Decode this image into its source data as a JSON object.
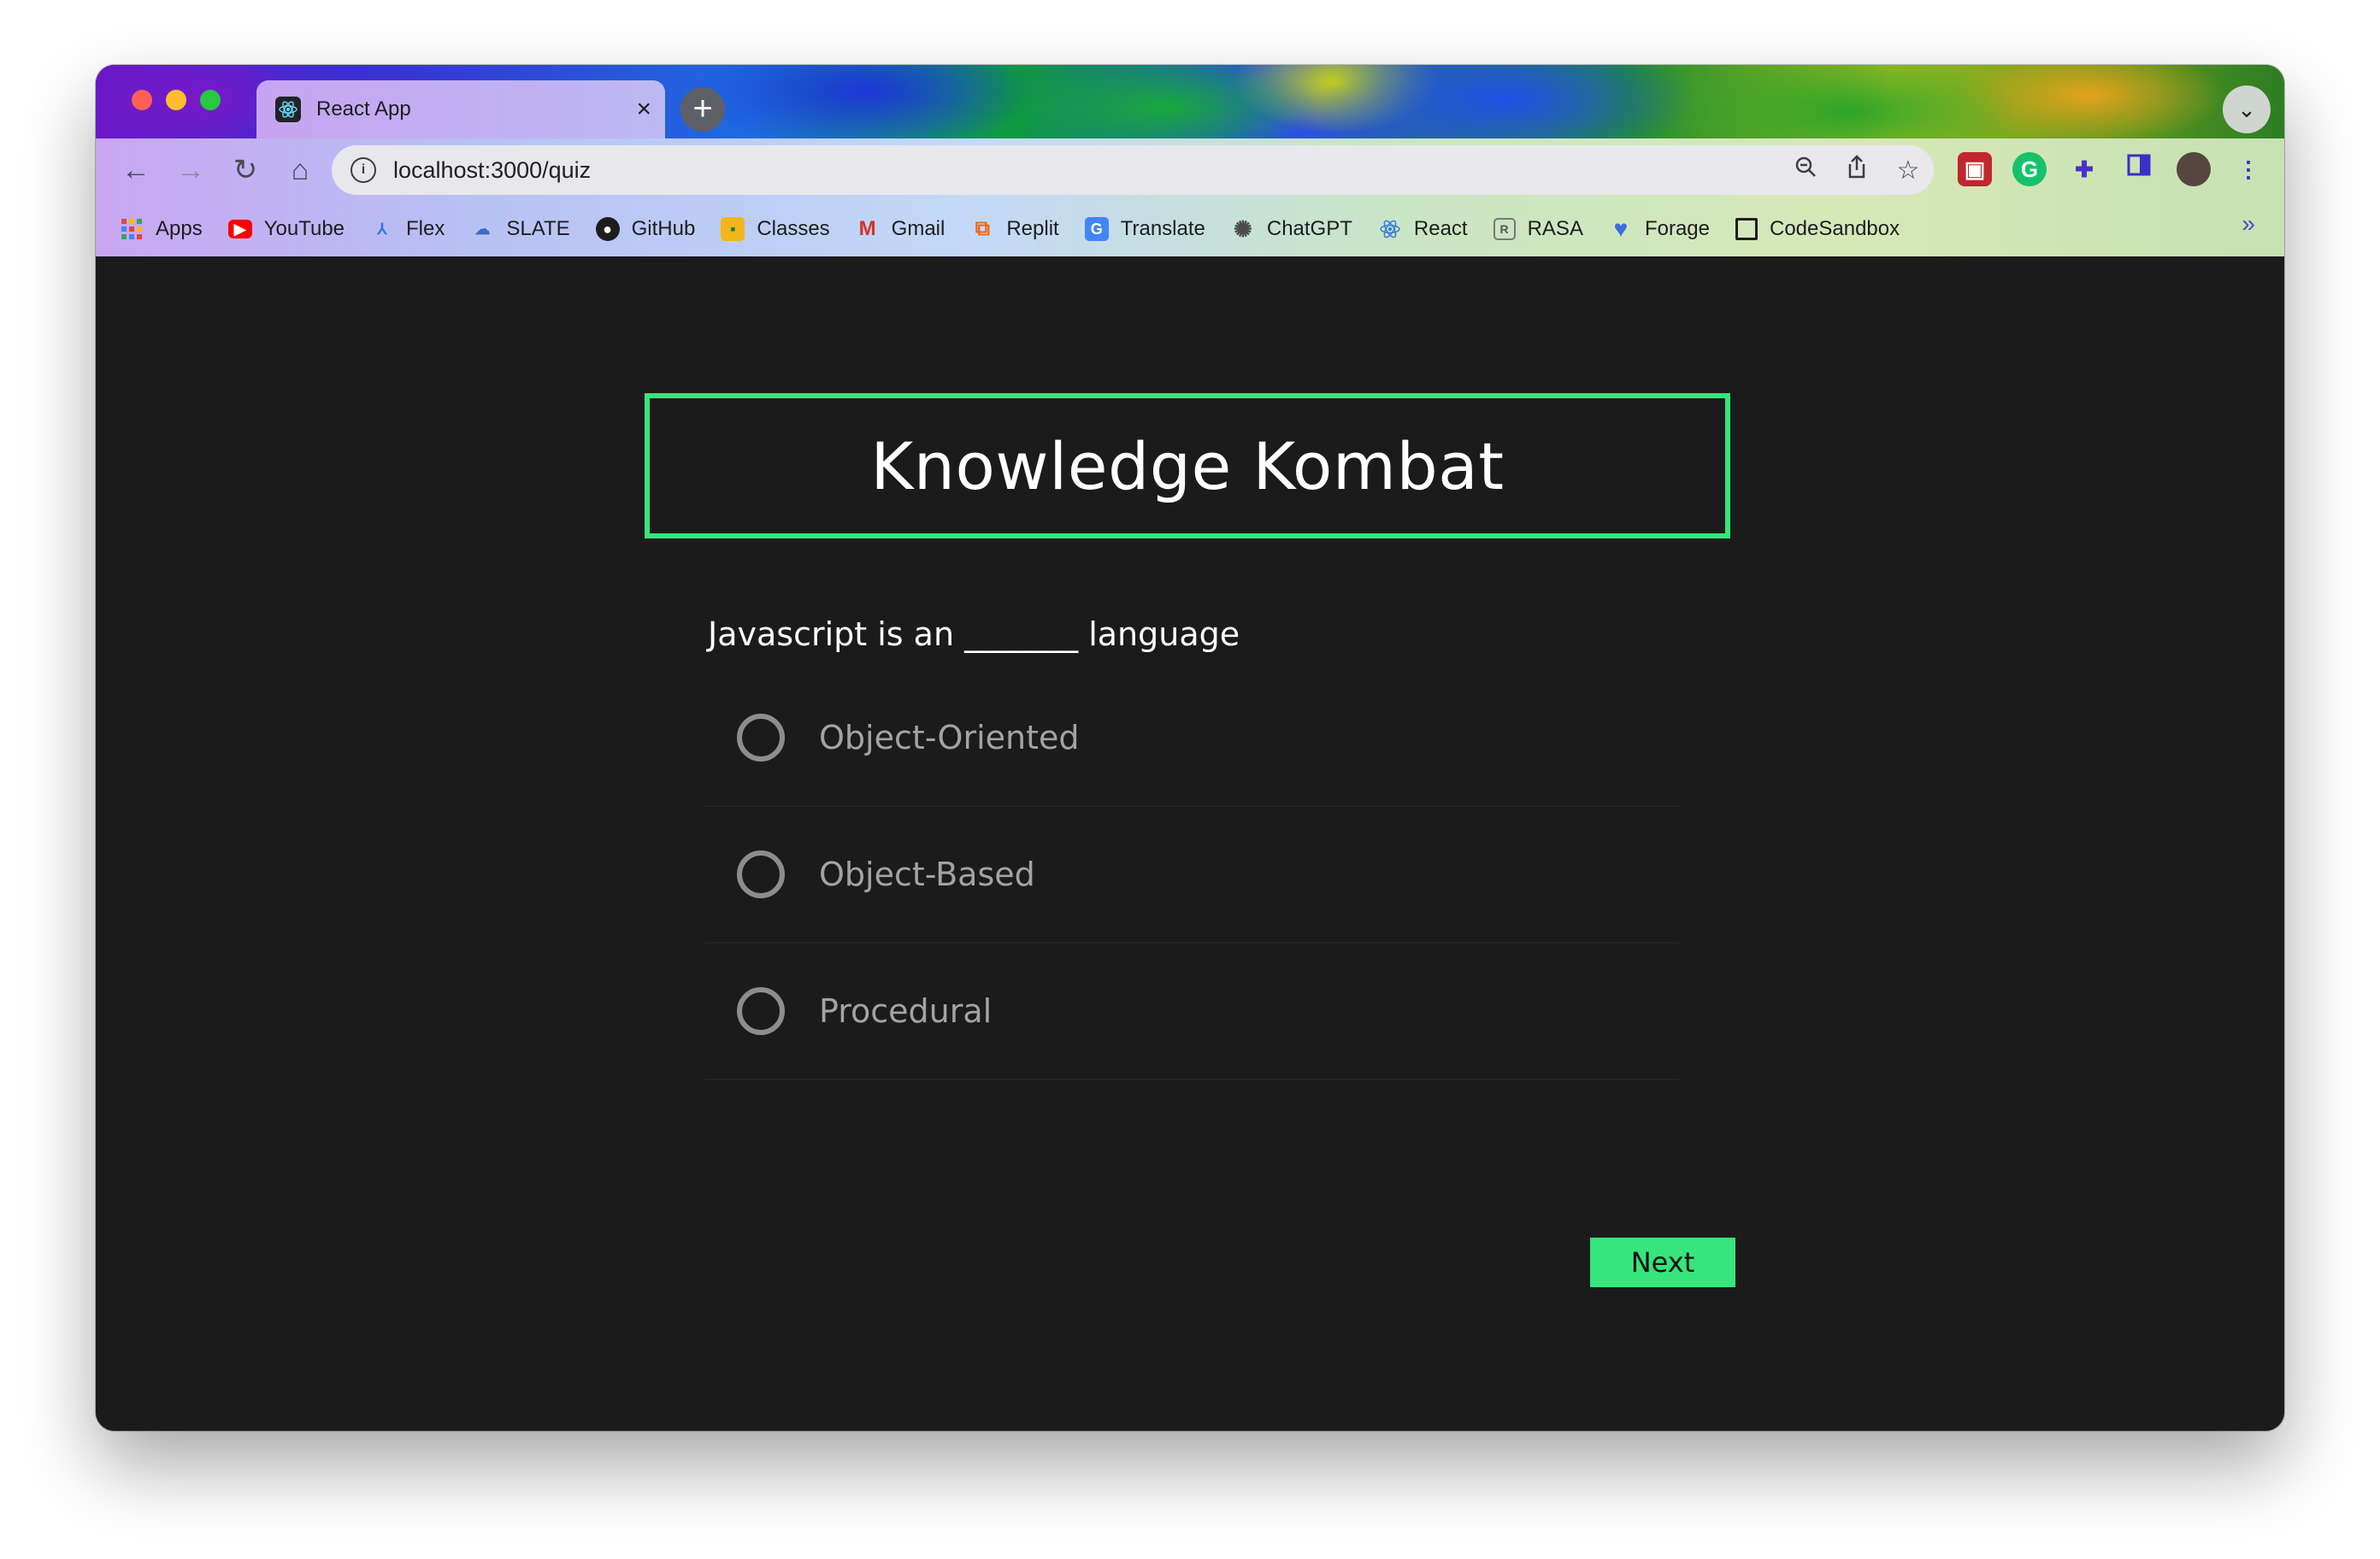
{
  "tab": {
    "title": "React App",
    "close": "×",
    "new_tab": "+"
  },
  "omnibox": {
    "url": "localhost:3000/quiz",
    "info": "i"
  },
  "bookmarks": [
    {
      "label": "Apps",
      "icon": "apps-grid-icon"
    },
    {
      "label": "YouTube",
      "icon": "youtube-icon"
    },
    {
      "label": "Flex",
      "icon": "flex-icon"
    },
    {
      "label": "SLATE",
      "icon": "slate-icon"
    },
    {
      "label": "GitHub",
      "icon": "github-icon"
    },
    {
      "label": "Classes",
      "icon": "classroom-icon"
    },
    {
      "label": "Gmail",
      "icon": "gmail-icon"
    },
    {
      "label": "Replit",
      "icon": "replit-icon"
    },
    {
      "label": "Translate",
      "icon": "translate-icon"
    },
    {
      "label": "ChatGPT",
      "icon": "chatgpt-icon"
    },
    {
      "label": "React",
      "icon": "react-icon"
    },
    {
      "label": "RASA",
      "icon": "rasa-icon"
    },
    {
      "label": "Forage",
      "icon": "forage-icon"
    },
    {
      "label": "CodeSandbox",
      "icon": "codesandbox-icon"
    }
  ],
  "bookmarks_more": "»",
  "quiz": {
    "title": "Knowledge Kombat",
    "question": "Javascript is an _______ language",
    "options": [
      "Object-Oriented",
      "Object-Based",
      "Procedural"
    ],
    "next_label": "Next"
  },
  "colors": {
    "accent": "#36e57b",
    "background": "#1b1b1b",
    "option_text": "#a3a3a3"
  }
}
